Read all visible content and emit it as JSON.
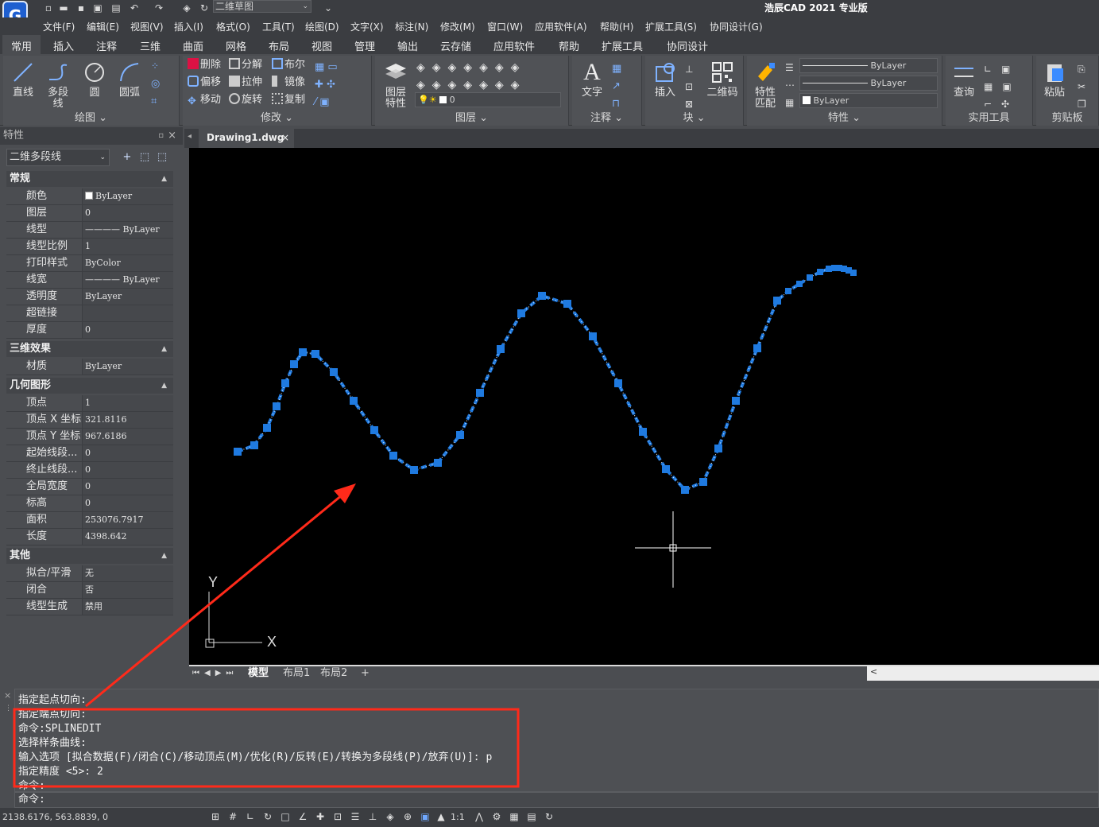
{
  "app": {
    "title": "浩辰CAD 2021 专业版",
    "workspace": "二维草图",
    "logo": "G"
  },
  "menus": [
    "文件(F)",
    "编辑(E)",
    "视图(V)",
    "插入(I)",
    "格式(O)",
    "工具(T)",
    "绘图(D)",
    "文字(X)",
    "标注(N)",
    "修改(M)",
    "窗口(W)",
    "应用软件(A)",
    "帮助(H)",
    "扩展工具(S)",
    "协同设计(G)"
  ],
  "ribbon_tabs": [
    "常用",
    "插入",
    "注释",
    "三维",
    "曲面",
    "网格",
    "布局",
    "视图",
    "管理",
    "输出",
    "云存储",
    "应用软件",
    "帮助",
    "扩展工具",
    "协同设计"
  ],
  "ribbon": {
    "draw": {
      "label": "绘图 ⌄",
      "line": "直线",
      "pline": "多段线",
      "circle": "圆",
      "arc": "圆弧"
    },
    "modify": {
      "label": "修改 ⌄",
      "erase": "删除",
      "explode": "分解",
      "boolean": "布尔",
      "offset": "偏移",
      "stretch": "拉伸",
      "mirror": "镜像",
      "move": "移动",
      "rotate": "旋转",
      "copy": "复制"
    },
    "layer": {
      "label": "图层 ⌄",
      "props": "图层特性",
      "current": "0"
    },
    "annot": {
      "label": "注释 ⌄",
      "text": "文字"
    },
    "block": {
      "label": "块 ⌄",
      "insert": "插入",
      "qrcode": "二维码"
    },
    "properties": {
      "label": "特性 ⌄",
      "match": "特性匹配",
      "linetype": "ByLayer",
      "lineweight": "ByLayer",
      "color": "ByLayer"
    },
    "utilities": {
      "label": "实用工具",
      "query": "查询"
    },
    "clipboard": {
      "label": "剪贴板",
      "paste": "粘贴"
    }
  },
  "props": {
    "header": "特性",
    "object": "二维多段线",
    "sections": {
      "general": "常规",
      "effects3d": "三维效果",
      "geometry": "几何图形",
      "misc": "其他"
    },
    "general": [
      [
        "颜色",
        "ByLayer"
      ],
      [
        "图层",
        "0"
      ],
      [
        "线型",
        "———— ByLayer"
      ],
      [
        "线型比例",
        "1"
      ],
      [
        "打印样式",
        "ByColor"
      ],
      [
        "线宽",
        "———— ByLayer"
      ],
      [
        "透明度",
        "ByLayer"
      ],
      [
        "超链接",
        ""
      ],
      [
        "厚度",
        "0"
      ]
    ],
    "effects3d": [
      [
        "材质",
        "ByLayer"
      ]
    ],
    "geometry": [
      [
        "顶点",
        "1"
      ],
      [
        "顶点 X 坐标",
        "321.8116"
      ],
      [
        "顶点 Y 坐标",
        "967.6186"
      ],
      [
        "起始线段...",
        "0"
      ],
      [
        "终止线段...",
        "0"
      ],
      [
        "全局宽度",
        "0"
      ],
      [
        "标高",
        "0"
      ],
      [
        "面积",
        "253076.7917"
      ],
      [
        "长度",
        "4398.642"
      ]
    ],
    "misc": [
      [
        "拟合/平滑",
        "无"
      ],
      [
        "闭合",
        "否"
      ],
      [
        "线型生成",
        "禁用"
      ]
    ]
  },
  "document": {
    "tab": "Drawing1.dwg",
    "close": "×"
  },
  "canvas": {
    "ucs_x": "X",
    "ucs_y": "Y",
    "curve_color": "#1f7ae0",
    "annotation_color": "#ff2a1a"
  },
  "layout_tabs": [
    "模型",
    "布局1",
    "布局2",
    "+"
  ],
  "command": {
    "history": [
      "指定起点切向:",
      "指定端点切向:",
      "命令:SPLINEDIT",
      "选择样条曲线:",
      "输入选项 [拟合数据(F)/闭合(C)/移动顶点(M)/优化(R)/反转(E)/转换为多段线(P)/放弃(U)]: p",
      "指定精度 <5>: 2",
      "命令:"
    ],
    "prompt": "命令:"
  },
  "status": {
    "coords": "2138.6176, 563.8839, 0",
    "scale": "1:1"
  }
}
